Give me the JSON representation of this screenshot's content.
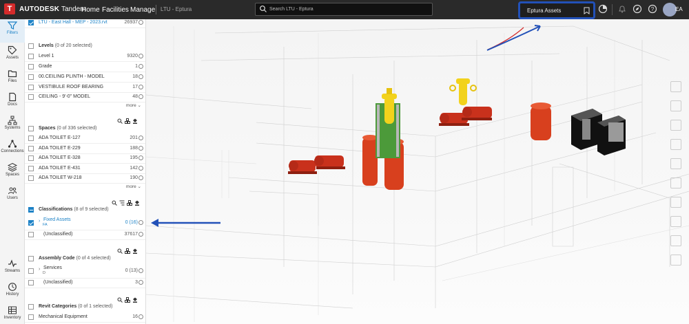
{
  "header": {
    "brand": "AUTODESK",
    "product": "Tandem",
    "nav": [
      "Home",
      "Facilities",
      "Manage"
    ],
    "breadcrumb": "LTU - Eptura",
    "search_placeholder": "Search LTU - Eptura",
    "saved_view": "Eptura Assets",
    "user_initials": "EA"
  },
  "rail": [
    {
      "label": "Filters",
      "icon": "filter-icon",
      "active": true
    },
    {
      "label": "Assets",
      "icon": "tag-icon"
    },
    {
      "label": "Files",
      "icon": "folder-icon"
    },
    {
      "label": "Docs",
      "icon": "document-icon"
    },
    {
      "label": "Systems",
      "icon": "systems-icon"
    },
    {
      "label": "Connections",
      "icon": "connections-icon"
    },
    {
      "label": "Spaces",
      "icon": "layers-icon"
    },
    {
      "label": "Users",
      "icon": "users-icon"
    },
    {
      "label": "Streams",
      "icon": "pulse-icon"
    },
    {
      "label": "History",
      "icon": "history-icon"
    },
    {
      "label": "Inventory",
      "icon": "table-icon"
    }
  ],
  "filters": {
    "model": {
      "name": "LTU - East Hall - MEP - 2023.rvt",
      "count": "26937"
    },
    "levels": {
      "title": "Levels",
      "selection": "(0 of 20 selected)",
      "items": [
        {
          "label": "Level 1",
          "count": "9320"
        },
        {
          "label": "Grade",
          "count": "1"
        },
        {
          "label": "00.CEILING PLINTH - MODEL",
          "count": "18"
        },
        {
          "label": "VESTIBULE ROOF BEARING",
          "count": "17"
        },
        {
          "label": "CEILING - 9'-0\" MODEL",
          "count": "48"
        }
      ],
      "more": "more"
    },
    "spaces": {
      "title": "Spaces",
      "selection": "(0 of 336 selected)",
      "items": [
        {
          "label": "ADA TOILET E-127",
          "count": "201"
        },
        {
          "label": "ADA TOILET E-229",
          "count": "188"
        },
        {
          "label": "ADA TOILET E-328",
          "count": "195"
        },
        {
          "label": "ADA TOILET E-431",
          "count": "142"
        },
        {
          "label": "ADA TOILET W-218",
          "count": "190"
        }
      ],
      "more": "more"
    },
    "classifications": {
      "title": "Classifications",
      "selection": "(8 of 9 selected)",
      "items": [
        {
          "label": "Fixed Assets",
          "sub": "FA",
          "count": "0 (16)"
        },
        {
          "label": "(Unclassified)",
          "count": "37617"
        }
      ]
    },
    "assembly": {
      "title": "Assembly Code",
      "selection": "(0 of 4 selected)",
      "items": [
        {
          "label": "Services",
          "sub": "D",
          "count": "0 (13)"
        },
        {
          "label": "(Unclassified)",
          "count": "3"
        }
      ]
    },
    "revit": {
      "title": "Revit Categories",
      "selection": "(0 of 1 selected)",
      "items": [
        {
          "label": "Mechanical Equipment",
          "count": "16"
        }
      ]
    }
  },
  "colors": {
    "topbar": "#2a2a2a",
    "accent": "#1d82c6",
    "highlight": "#2251b8",
    "equipment_red": "#d8401e",
    "equipment_yellow": "#f2d21c"
  }
}
